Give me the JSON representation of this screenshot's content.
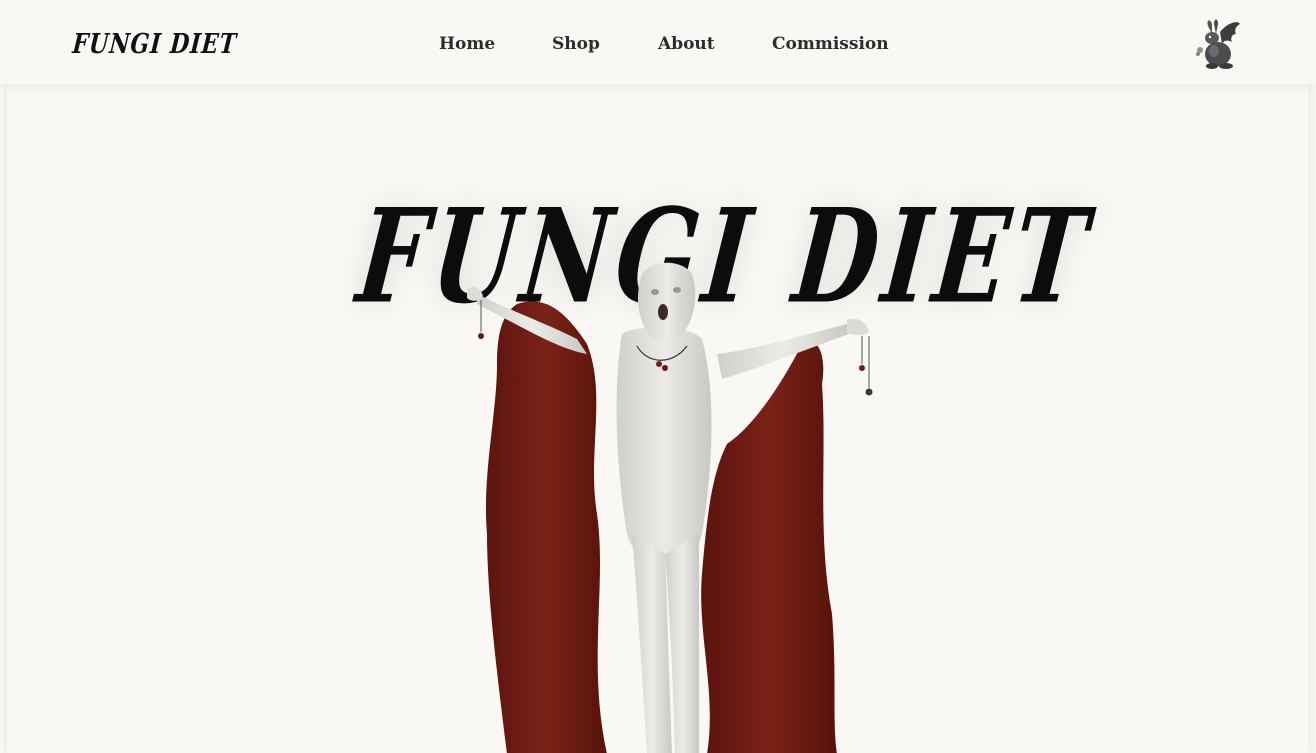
{
  "header": {
    "logo_text": "FUNGI DIET",
    "nav": [
      {
        "label": "Home"
      },
      {
        "label": "Shop"
      },
      {
        "label": "About"
      },
      {
        "label": "Commission"
      }
    ],
    "bunny_icon": "bunny-icon"
  },
  "hero": {
    "title": "FUNGI DIET",
    "artwork": "robed-figure-illustration"
  },
  "colors": {
    "background": "#f9f8f5",
    "nav_text": "#2d2d2d",
    "robe": "#6b1a12",
    "logo": "#0c0c0c"
  }
}
